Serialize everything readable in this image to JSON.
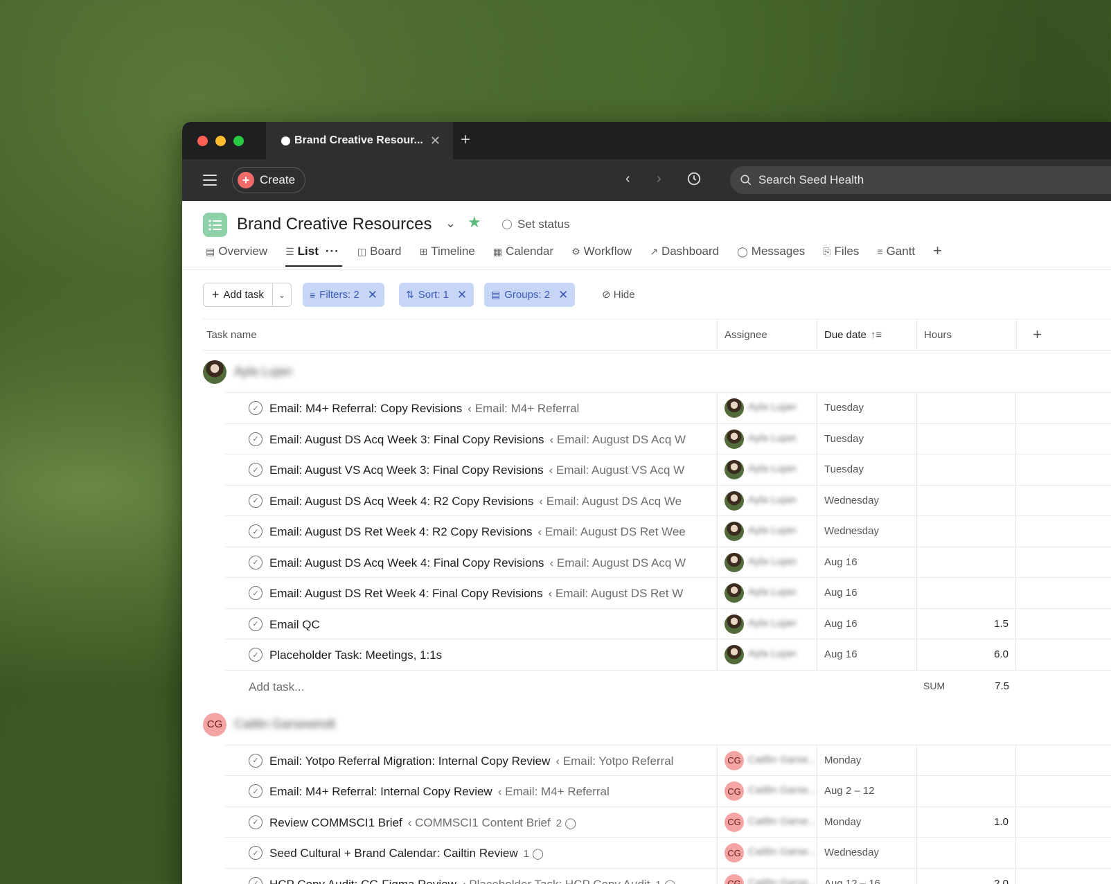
{
  "tab": {
    "title": "Brand Creative Resour...",
    "close": "✕",
    "new": "+"
  },
  "toolbar": {
    "create_label": "Create",
    "search_placeholder": "Search Seed Health"
  },
  "project": {
    "title": "Brand Creative Resources",
    "set_status": "Set status",
    "views": [
      {
        "label": "Overview",
        "icon": "overview-icon",
        "glyph": "▤"
      },
      {
        "label": "List",
        "icon": "list-icon",
        "glyph": "☰",
        "active": true
      },
      {
        "label": "Board",
        "icon": "board-icon",
        "glyph": "◫"
      },
      {
        "label": "Timeline",
        "icon": "timeline-icon",
        "glyph": "⊞"
      },
      {
        "label": "Calendar",
        "icon": "calendar-icon",
        "glyph": "▦"
      },
      {
        "label": "Workflow",
        "icon": "workflow-icon",
        "glyph": "⚙"
      },
      {
        "label": "Dashboard",
        "icon": "dashboard-icon",
        "glyph": "↗"
      },
      {
        "label": "Messages",
        "icon": "messages-icon",
        "glyph": "◯"
      },
      {
        "label": "Files",
        "icon": "files-icon",
        "glyph": "⎘"
      },
      {
        "label": "Gantt",
        "icon": "gantt-icon",
        "glyph": "≡"
      }
    ]
  },
  "filters": {
    "add_task": "Add task",
    "filters_label": "Filters: 2",
    "sort_label": "Sort: 1",
    "groups_label": "Groups: 2",
    "hide_label": "Hide"
  },
  "columns": {
    "task_name": "Task name",
    "assignee": "Assignee",
    "due_date": "Due date",
    "hours": "Hours"
  },
  "colors": {
    "accent_chip": "#c7d6f7",
    "create_plus": "#f06a6a",
    "project_icon": "#8ed0a8",
    "star": "#5dba7d",
    "cg_avatar": "#f5a3a3"
  },
  "sections": [
    {
      "name": "Ayla Lujan",
      "avatar_type": "photo",
      "sum_label": "SUM",
      "sum_value": "7.5",
      "add_task": "Add task...",
      "tasks": [
        {
          "name": "Email: M4+ Referral: Copy Revisions",
          "parent": "‹ Email: M4+ Referral",
          "assignee": "Ayla Lujan",
          "due": "Tuesday",
          "hours": ""
        },
        {
          "name": "Email: August DS Acq Week 3: Final Copy Revisions",
          "parent": "‹ Email: August DS Acq W",
          "assignee": "Ayla Lujan",
          "due": "Tuesday",
          "hours": ""
        },
        {
          "name": "Email: August VS Acq Week 3: Final Copy Revisions",
          "parent": "‹ Email: August VS Acq W",
          "assignee": "Ayla Lujan",
          "due": "Tuesday",
          "hours": ""
        },
        {
          "name": "Email: August DS Acq Week 4: R2 Copy Revisions",
          "parent": "‹ Email: August DS Acq We",
          "assignee": "Ayla Lujan",
          "due": "Wednesday",
          "hours": ""
        },
        {
          "name": "Email: August DS Ret Week 4: R2 Copy Revisions",
          "parent": "‹ Email: August DS Ret Wee",
          "assignee": "Ayla Lujan",
          "due": "Wednesday",
          "hours": ""
        },
        {
          "name": "Email: August DS Acq Week 4: Final Copy Revisions",
          "parent": "‹ Email: August DS Acq W",
          "assignee": "Ayla Lujan",
          "due": "Aug 16",
          "hours": ""
        },
        {
          "name": "Email: August DS Ret Week 4: Final Copy Revisions",
          "parent": "‹ Email: August DS Ret W",
          "assignee": "Ayla Lujan",
          "due": "Aug 16",
          "hours": ""
        },
        {
          "name": "Email QC",
          "parent": "",
          "assignee": "Ayla Lujan",
          "due": "Aug 16",
          "hours": "1.5"
        },
        {
          "name": "Placeholder Task: Meetings, 1:1s",
          "parent": "",
          "assignee": "Ayla Lujan",
          "due": "Aug 16",
          "hours": "6.0"
        }
      ]
    },
    {
      "name": "Caitlin Garsewindt",
      "avatar_type": "initials",
      "initials": "CG",
      "tasks": [
        {
          "name": "Email: Yotpo Referral Migration: Internal Copy Review",
          "parent": "‹ Email: Yotpo Referral",
          "assignee": "Caitlin Garse...",
          "due": "Monday",
          "hours": ""
        },
        {
          "name": "Email: M4+ Referral: Internal Copy Review",
          "parent": "‹ Email: M4+ Referral",
          "assignee": "Caitlin Garse...",
          "due": "Aug 2 – 12",
          "hours": ""
        },
        {
          "name": "Review COMMSCI1 Brief",
          "parent": "‹ COMMSCI1 Content Brief",
          "comments": "2",
          "assignee": "Caitlin Garse...",
          "due": "Monday",
          "hours": "1.0"
        },
        {
          "name": "Seed Cultural + Brand Calendar: Cailtin Review",
          "parent": "",
          "comments": "1",
          "assignee": "Caitlin Garse...",
          "due": "Wednesday",
          "hours": ""
        },
        {
          "name": "HCP Copy Audit: CG Figma Review",
          "parent": "‹ Placeholder Task: HCP Copy Audit",
          "comments": "1",
          "assignee": "Caitlin Garse...",
          "due": "Aug 12 – 16",
          "hours": "2.0"
        }
      ]
    }
  ]
}
